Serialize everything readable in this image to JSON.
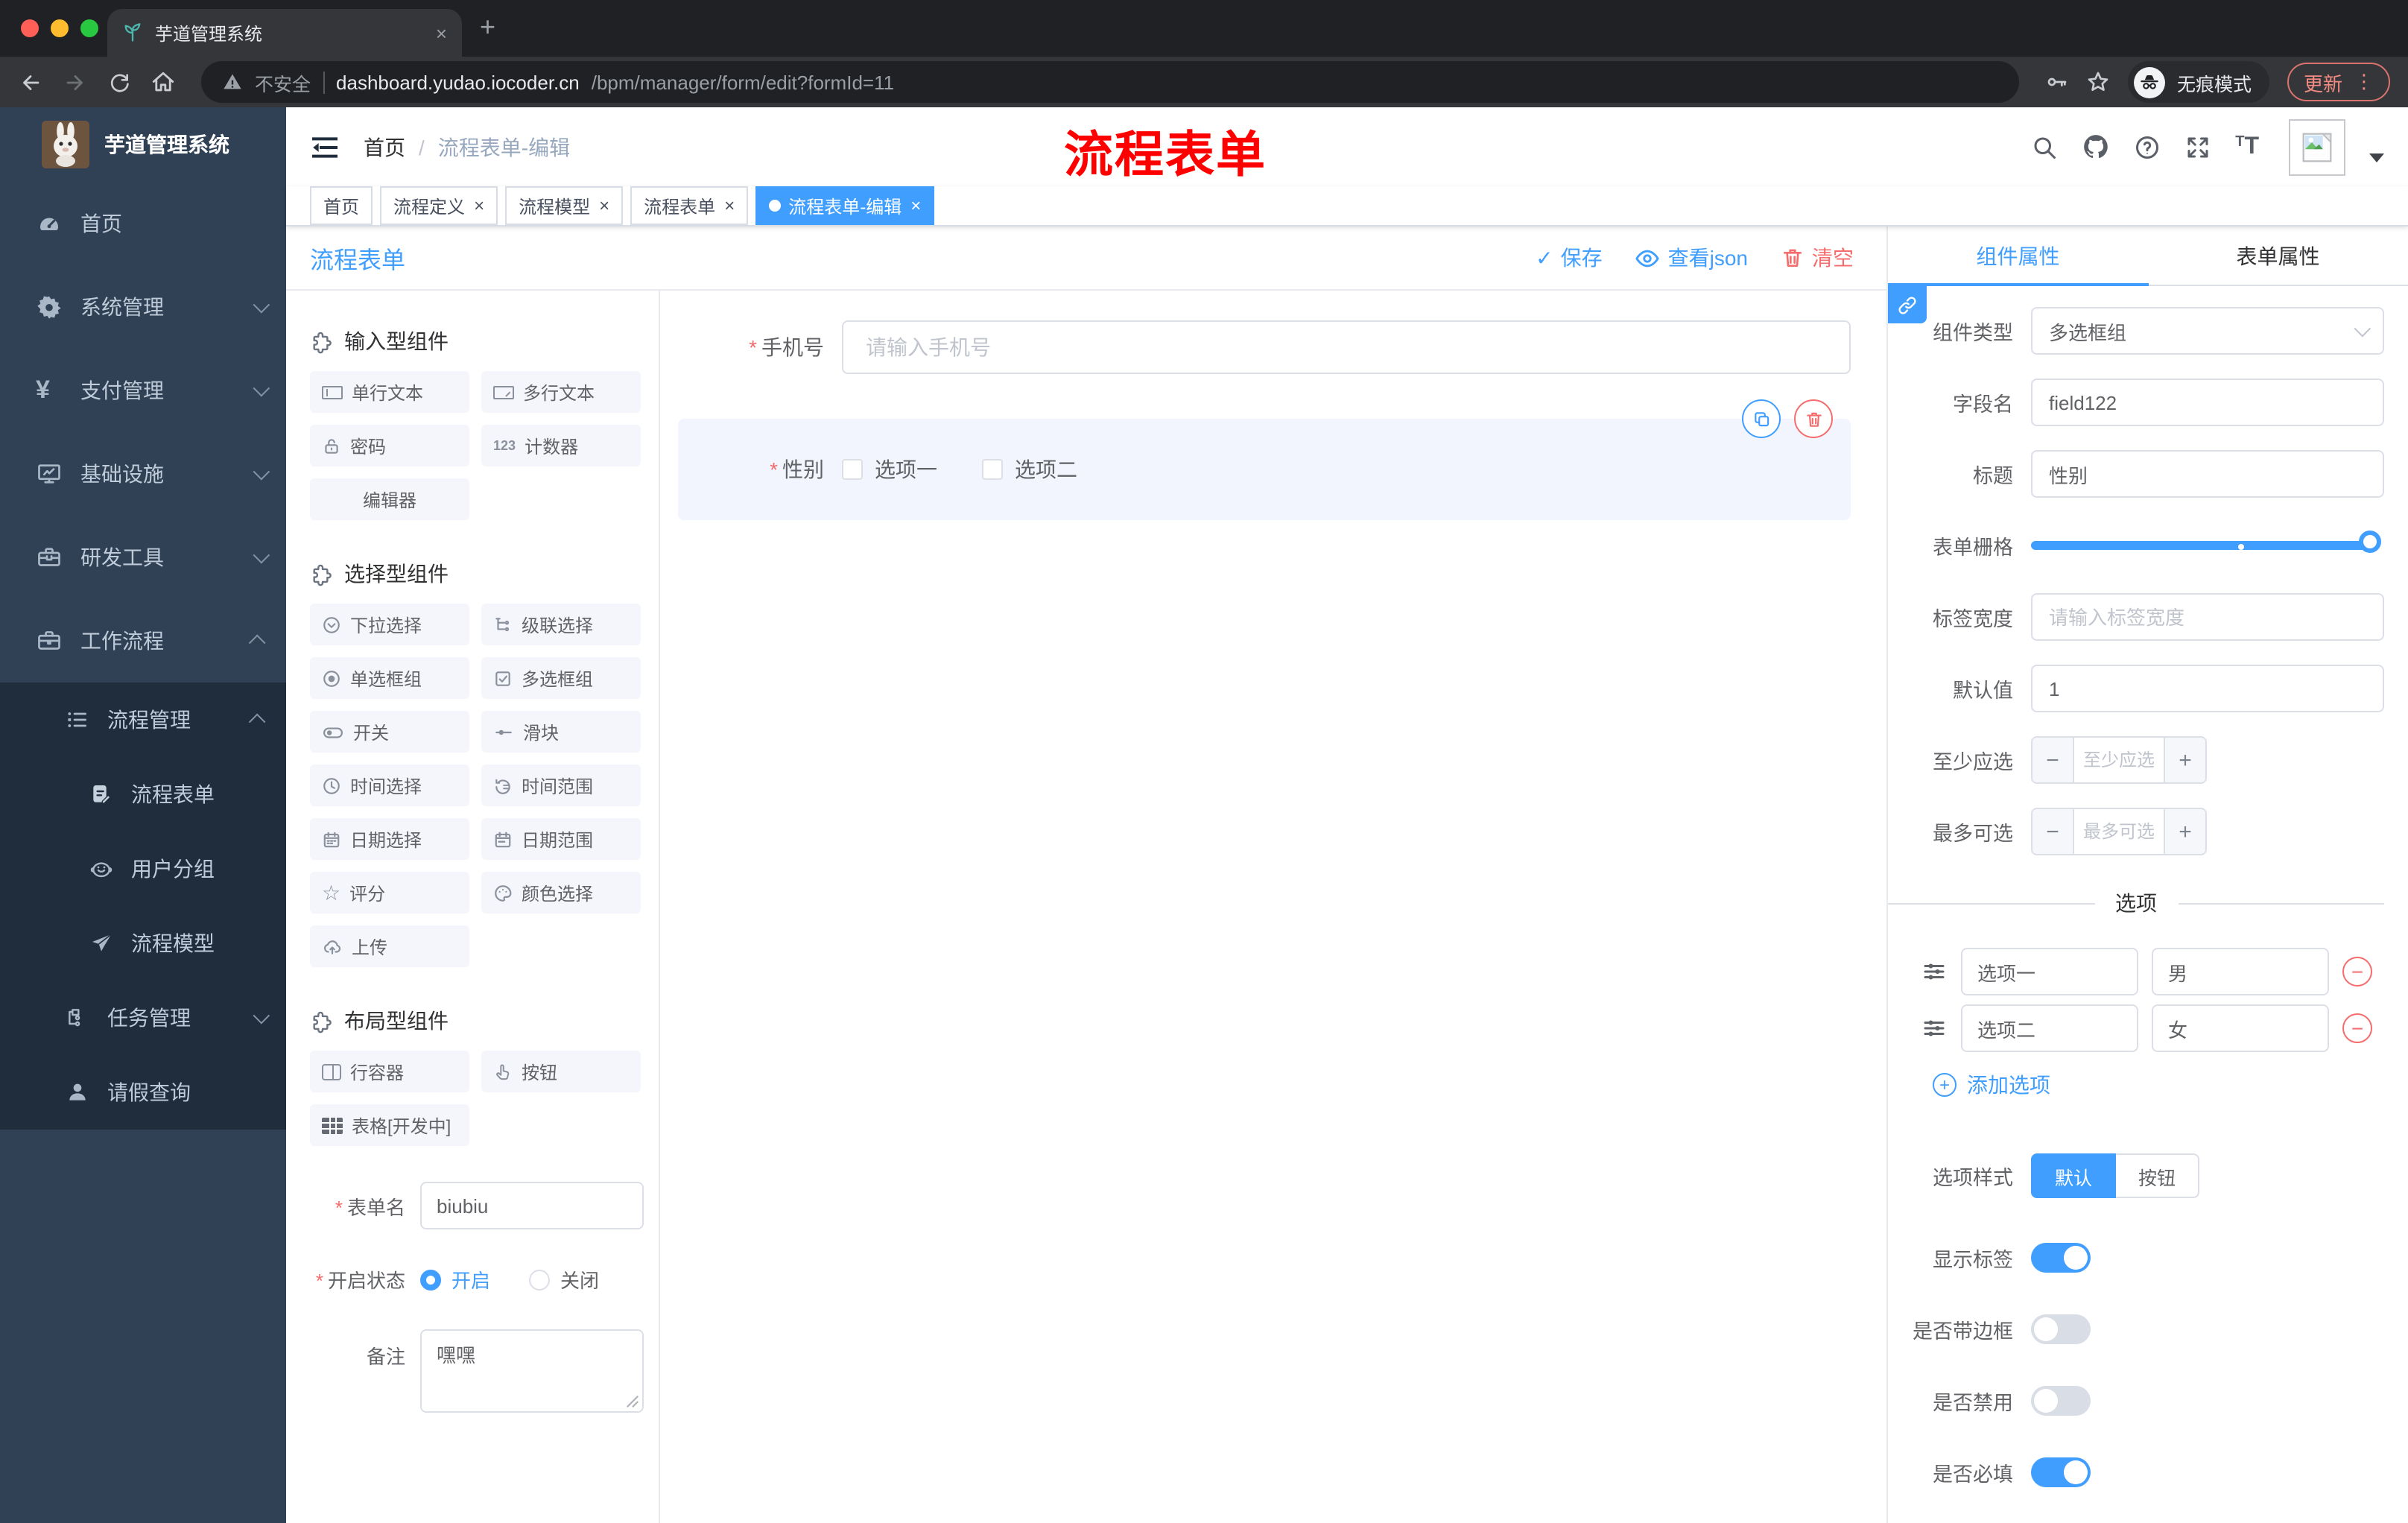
{
  "colors": {
    "primary": "#409eff",
    "danger": "#f56c6c",
    "sidebar_bg": "#304156",
    "sidebar_sub_bg": "#1f2d3d",
    "chrome_bg": "#202124",
    "toolbar_bg": "#35363a",
    "traffic_red": "#ff5f57",
    "traffic_yellow": "#febc2e",
    "traffic_green": "#28c840"
  },
  "browser": {
    "tab_title": "芋道管理系统",
    "close_tab": "×",
    "new_tab": "+",
    "security": "不安全",
    "url_host": "dashboard.yudao.iocoder.cn",
    "url_path": "/bpm/manager/form/edit?formId=11",
    "incognito": "无痕模式",
    "update": "更新",
    "menu_dots": "⋮"
  },
  "sidebar": {
    "app_title": "芋道管理系统",
    "items": [
      {
        "label": "首页"
      },
      {
        "label": "系统管理"
      },
      {
        "label": "支付管理"
      },
      {
        "label": "基础设施"
      },
      {
        "label": "研发工具"
      },
      {
        "label": "工作流程"
      },
      {
        "label": "流程管理"
      },
      {
        "label": "流程表单"
      },
      {
        "label": "用户分组"
      },
      {
        "label": "流程模型"
      },
      {
        "label": "任务管理"
      },
      {
        "label": "请假查询"
      }
    ]
  },
  "header": {
    "breadcrumb_home": "首页",
    "breadcrumb_sep": "/",
    "breadcrumb_current": "流程表单-编辑",
    "annotation": "流程表单"
  },
  "tags": [
    {
      "label": "首页"
    },
    {
      "label": "流程定义",
      "close": "×"
    },
    {
      "label": "流程模型",
      "close": "×"
    },
    {
      "label": "流程表单",
      "close": "×"
    },
    {
      "label": "流程表单-编辑",
      "close": "×"
    }
  ],
  "designer": {
    "title": "流程表单",
    "save": "保存",
    "view_json": "查看json",
    "clear": "清空",
    "check": "✓",
    "sections": {
      "input": {
        "title": "输入型组件",
        "items": [
          "单行文本",
          "多行文本",
          "密码",
          "计数器",
          "编辑器"
        ]
      },
      "select": {
        "title": "选择型组件",
        "items": [
          "下拉选择",
          "级联选择",
          "单选框组",
          "多选框组",
          "开关",
          "滑块",
          "时间选择",
          "时间范围",
          "日期选择",
          "日期范围",
          "评分",
          "颜色选择",
          "上传"
        ]
      },
      "layout": {
        "title": "布局型组件",
        "items": [
          "行容器",
          "按钮",
          "表格[开发中]"
        ]
      }
    },
    "form": {
      "name_label": "表单名",
      "name_value": "biubiu",
      "status_label": "开启状态",
      "status_on": "开启",
      "status_off": "关闭",
      "remark_label": "备注",
      "remark_value": "嘿嘿"
    },
    "canvas": {
      "phone_label": "手机号",
      "phone_placeholder": "请输入手机号",
      "gender_label": "性别",
      "option1": "选项一",
      "option2": "选项二"
    }
  },
  "props": {
    "tab_component": "组件属性",
    "tab_form": "表单属性",
    "component_type_label": "组件类型",
    "component_type_value": "多选框组",
    "field_name_label": "字段名",
    "field_name_value": "field122",
    "title_label": "标题",
    "title_value": "性别",
    "grid_label": "表单栅格",
    "label_width_label": "标签宽度",
    "label_width_placeholder": "请输入标签宽度",
    "default_label": "默认值",
    "default_value": "1",
    "min_label": "至少应选",
    "min_placeholder": "至少应选",
    "max_label": "最多可选",
    "max_placeholder": "最多可选",
    "minus": "−",
    "plus": "+",
    "options_title": "选项",
    "options": [
      {
        "label": "选项一",
        "value": "男"
      },
      {
        "label": "选项二",
        "value": "女"
      }
    ],
    "add_option": "添加选项",
    "style_label": "选项样式",
    "style_default": "默认",
    "style_button": "按钮",
    "switches": [
      {
        "label": "显示标签"
      },
      {
        "label": "是否带边框"
      },
      {
        "label": "是否禁用"
      },
      {
        "label": "是否必填"
      }
    ]
  }
}
